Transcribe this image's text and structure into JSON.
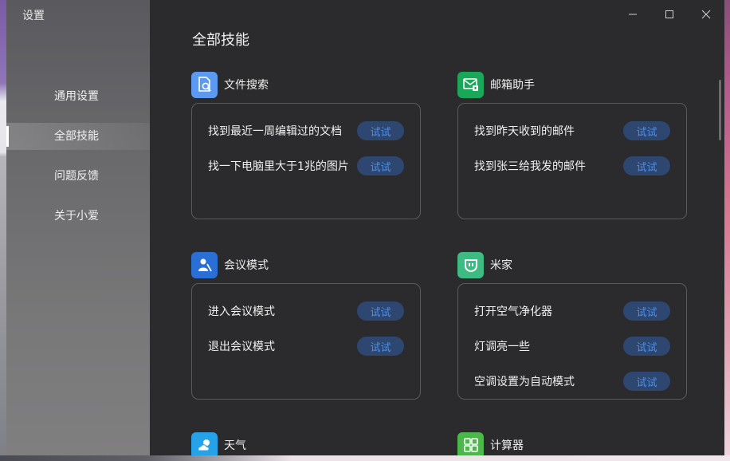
{
  "app": {
    "title": "设置"
  },
  "sidebar": {
    "items": [
      {
        "label": "通用设置",
        "active": false
      },
      {
        "label": "全部技能",
        "active": true
      },
      {
        "label": "问题反馈",
        "active": false
      },
      {
        "label": "关于小爱",
        "active": false
      }
    ]
  },
  "window_controls": {
    "minimize": "minimize-icon",
    "maximize": "maximize-icon",
    "close": "close-icon"
  },
  "main": {
    "title": "全部技能",
    "try_label": "试试",
    "sections": [
      {
        "title": "文件搜索",
        "icon": "file-search-icon",
        "icon_color": "#5b9af0",
        "items": [
          "找到最近一周编辑过的文档",
          "找一下电脑里大于1兆的图片"
        ]
      },
      {
        "title": "邮箱助手",
        "icon": "mail-icon",
        "icon_color": "#1aa75a",
        "items": [
          "找到昨天收到的邮件",
          "找到张三给我发的邮件"
        ]
      },
      {
        "title": "会议模式",
        "icon": "meeting-icon",
        "icon_color": "#2a6fd6",
        "items": [
          "进入会议模式",
          "退出会议模式"
        ]
      },
      {
        "title": "米家",
        "icon": "mijia-icon",
        "icon_color": "#3dbb83",
        "items": [
          "打开空气净化器",
          "灯调亮一些",
          "空调设置为自动模式"
        ]
      },
      {
        "title": "天气",
        "icon": "weather-icon",
        "icon_color": "#26a3e8",
        "items": []
      },
      {
        "title": "计算器",
        "icon": "calculator-icon",
        "icon_color": "#4cb84c",
        "items": []
      }
    ]
  },
  "colors": {
    "background": "#2b2b2d",
    "button_bg": "#2e4770",
    "button_text": "#4d8fe8",
    "card_border": "#5a5a5d"
  }
}
